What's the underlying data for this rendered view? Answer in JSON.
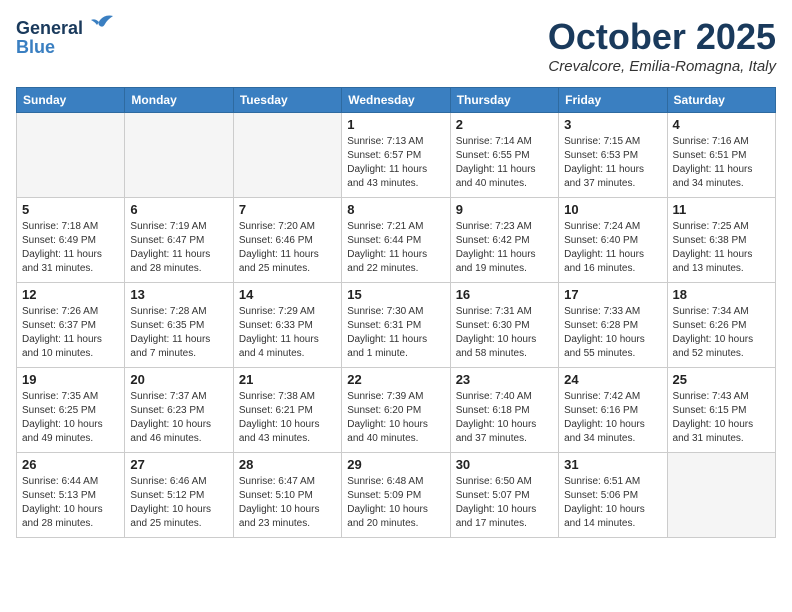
{
  "header": {
    "logo_line1": "General",
    "logo_line2": "Blue",
    "month": "October 2025",
    "location": "Crevalcore, Emilia-Romagna, Italy"
  },
  "weekdays": [
    "Sunday",
    "Monday",
    "Tuesday",
    "Wednesday",
    "Thursday",
    "Friday",
    "Saturday"
  ],
  "weeks": [
    [
      {
        "day": "",
        "info": ""
      },
      {
        "day": "",
        "info": ""
      },
      {
        "day": "",
        "info": ""
      },
      {
        "day": "1",
        "info": "Sunrise: 7:13 AM\nSunset: 6:57 PM\nDaylight: 11 hours\nand 43 minutes."
      },
      {
        "day": "2",
        "info": "Sunrise: 7:14 AM\nSunset: 6:55 PM\nDaylight: 11 hours\nand 40 minutes."
      },
      {
        "day": "3",
        "info": "Sunrise: 7:15 AM\nSunset: 6:53 PM\nDaylight: 11 hours\nand 37 minutes."
      },
      {
        "day": "4",
        "info": "Sunrise: 7:16 AM\nSunset: 6:51 PM\nDaylight: 11 hours\nand 34 minutes."
      }
    ],
    [
      {
        "day": "5",
        "info": "Sunrise: 7:18 AM\nSunset: 6:49 PM\nDaylight: 11 hours\nand 31 minutes."
      },
      {
        "day": "6",
        "info": "Sunrise: 7:19 AM\nSunset: 6:47 PM\nDaylight: 11 hours\nand 28 minutes."
      },
      {
        "day": "7",
        "info": "Sunrise: 7:20 AM\nSunset: 6:46 PM\nDaylight: 11 hours\nand 25 minutes."
      },
      {
        "day": "8",
        "info": "Sunrise: 7:21 AM\nSunset: 6:44 PM\nDaylight: 11 hours\nand 22 minutes."
      },
      {
        "day": "9",
        "info": "Sunrise: 7:23 AM\nSunset: 6:42 PM\nDaylight: 11 hours\nand 19 minutes."
      },
      {
        "day": "10",
        "info": "Sunrise: 7:24 AM\nSunset: 6:40 PM\nDaylight: 11 hours\nand 16 minutes."
      },
      {
        "day": "11",
        "info": "Sunrise: 7:25 AM\nSunset: 6:38 PM\nDaylight: 11 hours\nand 13 minutes."
      }
    ],
    [
      {
        "day": "12",
        "info": "Sunrise: 7:26 AM\nSunset: 6:37 PM\nDaylight: 11 hours\nand 10 minutes."
      },
      {
        "day": "13",
        "info": "Sunrise: 7:28 AM\nSunset: 6:35 PM\nDaylight: 11 hours\nand 7 minutes."
      },
      {
        "day": "14",
        "info": "Sunrise: 7:29 AM\nSunset: 6:33 PM\nDaylight: 11 hours\nand 4 minutes."
      },
      {
        "day": "15",
        "info": "Sunrise: 7:30 AM\nSunset: 6:31 PM\nDaylight: 11 hours\nand 1 minute."
      },
      {
        "day": "16",
        "info": "Sunrise: 7:31 AM\nSunset: 6:30 PM\nDaylight: 10 hours\nand 58 minutes."
      },
      {
        "day": "17",
        "info": "Sunrise: 7:33 AM\nSunset: 6:28 PM\nDaylight: 10 hours\nand 55 minutes."
      },
      {
        "day": "18",
        "info": "Sunrise: 7:34 AM\nSunset: 6:26 PM\nDaylight: 10 hours\nand 52 minutes."
      }
    ],
    [
      {
        "day": "19",
        "info": "Sunrise: 7:35 AM\nSunset: 6:25 PM\nDaylight: 10 hours\nand 49 minutes."
      },
      {
        "day": "20",
        "info": "Sunrise: 7:37 AM\nSunset: 6:23 PM\nDaylight: 10 hours\nand 46 minutes."
      },
      {
        "day": "21",
        "info": "Sunrise: 7:38 AM\nSunset: 6:21 PM\nDaylight: 10 hours\nand 43 minutes."
      },
      {
        "day": "22",
        "info": "Sunrise: 7:39 AM\nSunset: 6:20 PM\nDaylight: 10 hours\nand 40 minutes."
      },
      {
        "day": "23",
        "info": "Sunrise: 7:40 AM\nSunset: 6:18 PM\nDaylight: 10 hours\nand 37 minutes."
      },
      {
        "day": "24",
        "info": "Sunrise: 7:42 AM\nSunset: 6:16 PM\nDaylight: 10 hours\nand 34 minutes."
      },
      {
        "day": "25",
        "info": "Sunrise: 7:43 AM\nSunset: 6:15 PM\nDaylight: 10 hours\nand 31 minutes."
      }
    ],
    [
      {
        "day": "26",
        "info": "Sunrise: 6:44 AM\nSunset: 5:13 PM\nDaylight: 10 hours\nand 28 minutes."
      },
      {
        "day": "27",
        "info": "Sunrise: 6:46 AM\nSunset: 5:12 PM\nDaylight: 10 hours\nand 25 minutes."
      },
      {
        "day": "28",
        "info": "Sunrise: 6:47 AM\nSunset: 5:10 PM\nDaylight: 10 hours\nand 23 minutes."
      },
      {
        "day": "29",
        "info": "Sunrise: 6:48 AM\nSunset: 5:09 PM\nDaylight: 10 hours\nand 20 minutes."
      },
      {
        "day": "30",
        "info": "Sunrise: 6:50 AM\nSunset: 5:07 PM\nDaylight: 10 hours\nand 17 minutes."
      },
      {
        "day": "31",
        "info": "Sunrise: 6:51 AM\nSunset: 5:06 PM\nDaylight: 10 hours\nand 14 minutes."
      },
      {
        "day": "",
        "info": ""
      }
    ]
  ]
}
